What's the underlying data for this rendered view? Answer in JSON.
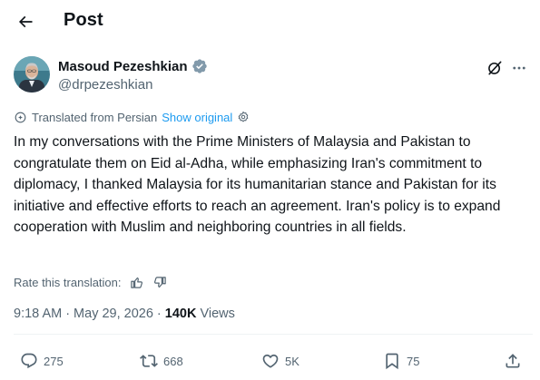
{
  "header": {
    "title": "Post"
  },
  "author": {
    "name": "Masoud Pezeshkian",
    "handle": "@drpezeshkian"
  },
  "translation": {
    "note": "Translated from Persian",
    "show_original": "Show original"
  },
  "post": {
    "text": "In my conversations with the Prime Ministers of Malaysia and Pakistan to congratulate them on Eid al-Adha, while emphasizing Iran's commitment to diplomacy, I thanked Malaysia for its humanitarian stance and Pakistan for its initiative and effective efforts to reach an agreement. Iran's policy is to expand cooperation with Muslim and neighboring countries in all fields."
  },
  "rate": {
    "label": "Rate this translation:"
  },
  "meta": {
    "time": "9:18 AM",
    "separator": "·",
    "date": "May 29, 2026",
    "views_count": "140K",
    "views_label": "Views"
  },
  "actions": {
    "replies": "275",
    "reposts": "668",
    "likes": "5K",
    "bookmarks": "75"
  },
  "colors": {
    "accent": "#1d9bf0",
    "verified": "#829aab",
    "muted": "#536471",
    "text": "#0f1419"
  },
  "icons": [
    "back-arrow-icon",
    "verified-badge-icon",
    "grok-icon",
    "more-icon",
    "translate-settings-icon",
    "thumbs-up-icon",
    "thumbs-down-icon",
    "reply-icon",
    "repost-icon",
    "like-icon",
    "bookmark-icon",
    "share-icon"
  ]
}
